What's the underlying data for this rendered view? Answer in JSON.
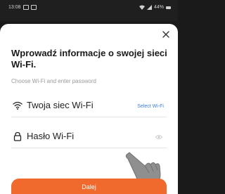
{
  "status_bar": {
    "time": "13:08",
    "battery": "44%"
  },
  "dialog": {
    "title": "Wprowadź informacje o swojej sieci Wi-Fi.",
    "subtitle": "Choose Wi-Fi and enter password",
    "ssid_field": {
      "value": "Twoja siec Wi-Fi",
      "icon": "wifi-icon",
      "select_link": "Select Wi-Fi"
    },
    "password_field": {
      "placeholder": "Hasło Wi-Fi",
      "icon": "lock-icon"
    },
    "next_button": "Dalej"
  },
  "colors": {
    "accent": "#ef6a2c",
    "link": "#3d7de0"
  }
}
